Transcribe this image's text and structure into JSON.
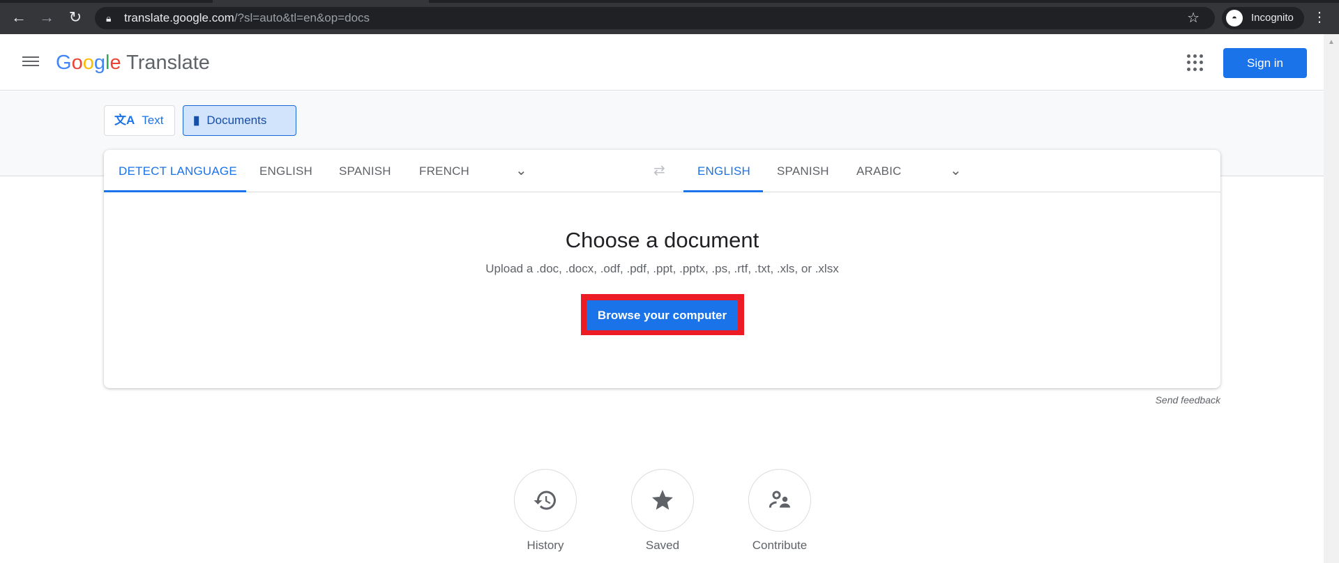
{
  "browser": {
    "url_host": "translate.google.com",
    "url_path": "/?sl=auto&tl=en&op=docs",
    "profile": "Incognito"
  },
  "header": {
    "logo_google": "Google",
    "logo_product": "Translate",
    "signin": "Sign in"
  },
  "modes": [
    {
      "label": "Text",
      "active": false
    },
    {
      "label": "Documents",
      "active": true
    }
  ],
  "source_langs": [
    "DETECT LANGUAGE",
    "ENGLISH",
    "SPANISH",
    "FRENCH"
  ],
  "target_langs": [
    "ENGLISH",
    "SPANISH",
    "ARABIC"
  ],
  "upload": {
    "title": "Choose a document",
    "subtitle": "Upload a .doc, .docx, .odf, .pdf, .ppt, .pptx, .ps, .rtf, .txt, .xls, or .xlsx",
    "button": "Browse your computer"
  },
  "feedback": "Send feedback",
  "bottom": [
    {
      "label": "History",
      "icon": "history-icon"
    },
    {
      "label": "Saved",
      "icon": "star-icon"
    },
    {
      "label": "Contribute",
      "icon": "contribute-icon"
    }
  ],
  "colors": {
    "accent": "#1a73e8",
    "highlight": "#ed1c24"
  }
}
